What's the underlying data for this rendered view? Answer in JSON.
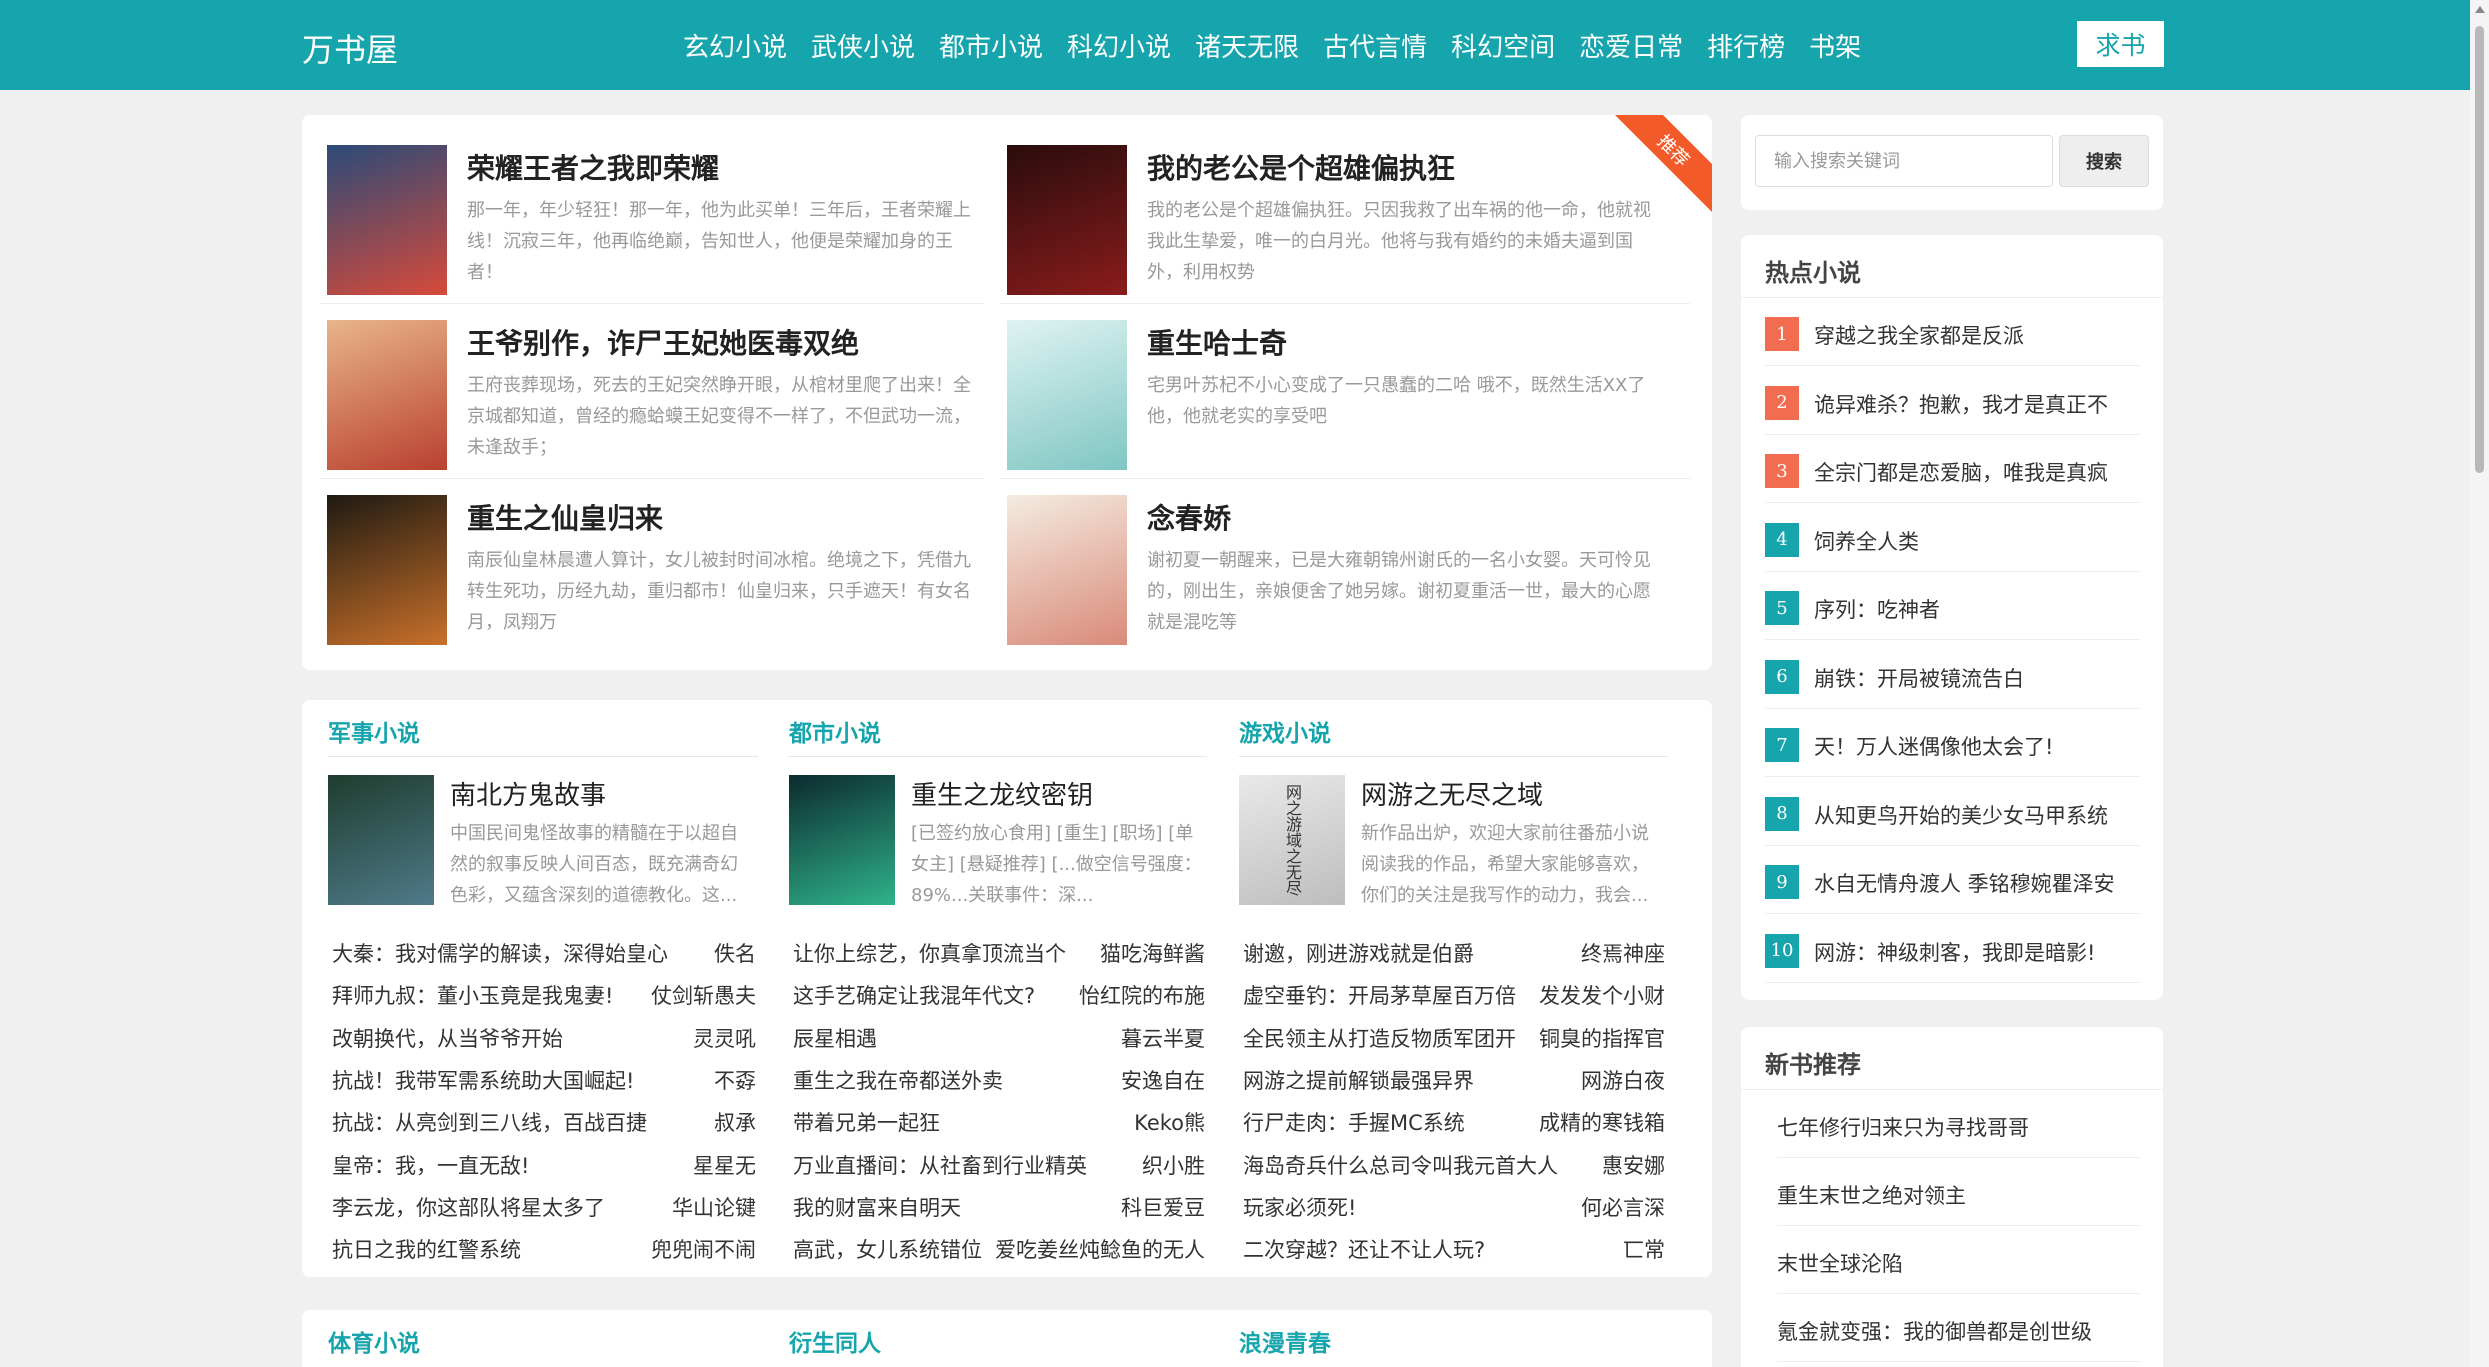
{
  "header": {
    "logo": "万书屋",
    "nav": [
      "玄幻小说",
      "武侠小说",
      "都市小说",
      "科幻小说",
      "诸天无限",
      "古代言情",
      "科幻空间",
      "恋爱日常",
      "排行榜",
      "书架"
    ],
    "request_button": "求书"
  },
  "featured": {
    "badge": "推荐",
    "books": [
      {
        "title": "荣耀王者之我即荣耀",
        "desc": "那一年，年少轻狂！那一年，他为此买单！三年后，王者荣耀上线！沉寂三年，他再临绝巅，告知世人，他便是荣耀加身的王者！",
        "cover_colors": [
          "#2b4a78",
          "#d64a3a"
        ]
      },
      {
        "title": "我的老公是个超雄偏执狂",
        "desc": "我的老公是个超雄偏执狂。只因我救了出车祸的他一命，他就视我此生挚爱，唯一的白月光。他将与我有婚约的未婚夫逼到国外，利用权势",
        "cover_colors": [
          "#2a0c0c",
          "#8a1c1c"
        ]
      },
      {
        "title": "王爷别作，诈尸王妃她医毒双绝",
        "desc": "王府丧葬现场，死去的王妃突然睁开眼，从棺材里爬了出来！全京城都知道，曾经的瘾蛤蟆王妃变得不一样了，不但武功一流，未逢敌手；",
        "cover_colors": [
          "#e8b58a",
          "#b9402f"
        ]
      },
      {
        "title": "重生哈士奇",
        "desc": "宅男叶苏杞不小心变成了一只愚蠢的二哈 哦不，既然生活XX了他，他就老实的享受吧",
        "cover_colors": [
          "#dff3f2",
          "#7fc6c2"
        ]
      },
      {
        "title": "重生之仙皇归来",
        "desc": "南辰仙皇林晨遭人算计，女儿被封时间冰棺。绝境之下，凭借九转生死功，历经九劫，重归都市！仙皇归来，只手遮天！有女名月，凤翔万",
        "cover_colors": [
          "#1e1a12",
          "#c9702a"
        ]
      },
      {
        "title": "念春娇",
        "desc": "谢初夏一朝醒来，已是大雍朝锦州谢氏的一名小女婴。天可怜见的，刚出生，亲娘便舍了她另嫁。谢初夏重活一世，最大的心愿就是混吃等",
        "cover_colors": [
          "#f4ece0",
          "#d98a7a"
        ]
      }
    ]
  },
  "search": {
    "placeholder": "输入搜索关键词",
    "button": "搜索"
  },
  "hot": {
    "heading": "热点小说",
    "items": [
      {
        "rank": "1",
        "title": "穿越之我全家都是反派"
      },
      {
        "rank": "2",
        "title": "诡异难杀？抱歉，我才是真正不"
      },
      {
        "rank": "3",
        "title": "全宗门都是恋爱脑，唯我是真疯"
      },
      {
        "rank": "4",
        "title": "饲养全人类"
      },
      {
        "rank": "5",
        "title": "序列：吃神者"
      },
      {
        "rank": "6",
        "title": "崩铁：开局被镜流告白"
      },
      {
        "rank": "7",
        "title": "天！万人迷偶像他太会了!"
      },
      {
        "rank": "8",
        "title": "从知更鸟开始的美少女马甲系统"
      },
      {
        "rank": "9",
        "title": "水自无情舟渡人 季铭穆婉瞿泽安"
      },
      {
        "rank": "10",
        "title": "网游：神级刺客，我即是暗影!"
      }
    ],
    "colors": {
      "top3": "#f26c4f",
      "rest": "#17a5ad"
    }
  },
  "new_books": {
    "heading": "新书推荐",
    "items": [
      "七年修行归来只为寻找哥哥",
      "重生末世之绝对领主",
      "末世全球沦陷",
      "氪金就变强：我的御兽都是创世级"
    ]
  },
  "categories": [
    {
      "name": "军事小说",
      "feature": {
        "title": "南北方鬼故事",
        "desc": "中国民间鬼怪故事的精髓在于以超自然的叙事反映人间百态，既充满奇幻色彩，又蕴含深刻的道德教化。这...",
        "cover_colors": [
          "#1f3d2e",
          "#4f7a8a"
        ]
      },
      "rows": [
        {
          "title": "大秦：我对儒学的解读，深得始皇心",
          "author": "佚名"
        },
        {
          "title": "拜师九叔：董小玉竟是我鬼妻!",
          "author": "仗剑斩愚夫"
        },
        {
          "title": "改朝换代，从当爷爷开始",
          "author": "灵灵吼"
        },
        {
          "title": "抗战！我带军需系统助大国崛起!",
          "author": "不孬"
        },
        {
          "title": "抗战：从亮剑到三八线，百战百捷",
          "author": "叔承"
        },
        {
          "title": "皇帝：我，一直无敌!",
          "author": "星星无"
        },
        {
          "title": "李云龙，你这部队将星太多了",
          "author": "华山论键"
        },
        {
          "title": "抗日之我的红警系统",
          "author": "兜兜闹不闹"
        }
      ]
    },
    {
      "name": "都市小说",
      "feature": {
        "title": "重生之龙纹密钥",
        "desc": "[已签约放心食用] [重生] [职场] [单女主] [悬疑推荐] [...做空信号强度：89%...关联事件：深...",
        "cover_colors": [
          "#0c2a2e",
          "#2fb38a"
        ]
      },
      "rows": [
        {
          "title": "让你上综艺，你真拿顶流当个",
          "author": "猫吃海鲜酱"
        },
        {
          "title": "这手艺确定让我混年代文?",
          "author": "怡红院的布施"
        },
        {
          "title": "辰星相遇",
          "author": "暮云半夏"
        },
        {
          "title": "重生之我在帝都送外卖",
          "author": "安逸自在"
        },
        {
          "title": "带着兄弟一起狂",
          "author": "Keko熊"
        },
        {
          "title": "万业直播间：从社畜到行业精英",
          "author": "织小胜"
        },
        {
          "title": "我的财富来自明天",
          "author": "科巨爱豆"
        },
        {
          "title": "高武，女儿系统错位",
          "author": "爱吃姜丝炖鲶鱼的无人"
        }
      ]
    },
    {
      "name": "游戏小说",
      "feature": {
        "title": "网游之无尽之域",
        "desc": "新作品出炉，欢迎大家前往番茄小说阅读我的作品，希望大家能够喜欢，你们的关注是我写作的动力，我会...",
        "cover_colors": [
          "#e9e9e9",
          "#bdbdbd"
        ],
        "cover_text": "网之游域之无尽"
      },
      "rows": [
        {
          "title": "谢邀，刚进游戏就是伯爵",
          "author": "终焉神座"
        },
        {
          "title": "虚空垂钓：开局茅草屋百万倍",
          "author": "发发发个小财"
        },
        {
          "title": "全民领主从打造反物质军团开",
          "author": "铜臭的指挥官"
        },
        {
          "title": "网游之提前解锁最强异界",
          "author": "网游白夜"
        },
        {
          "title": "行尸走肉：手握MC系统",
          "author": "成精的寒钱箱"
        },
        {
          "title": "海岛奇兵什么总司令叫我元首大人",
          "author": "惠安娜"
        },
        {
          "title": "玩家必须死!",
          "author": "何必言深"
        },
        {
          "title": "二次穿越？还让不让人玩?",
          "author": "匸常"
        }
      ]
    }
  ],
  "categories2": [
    "体育小说",
    "衍生同人",
    "浪漫青春"
  ]
}
